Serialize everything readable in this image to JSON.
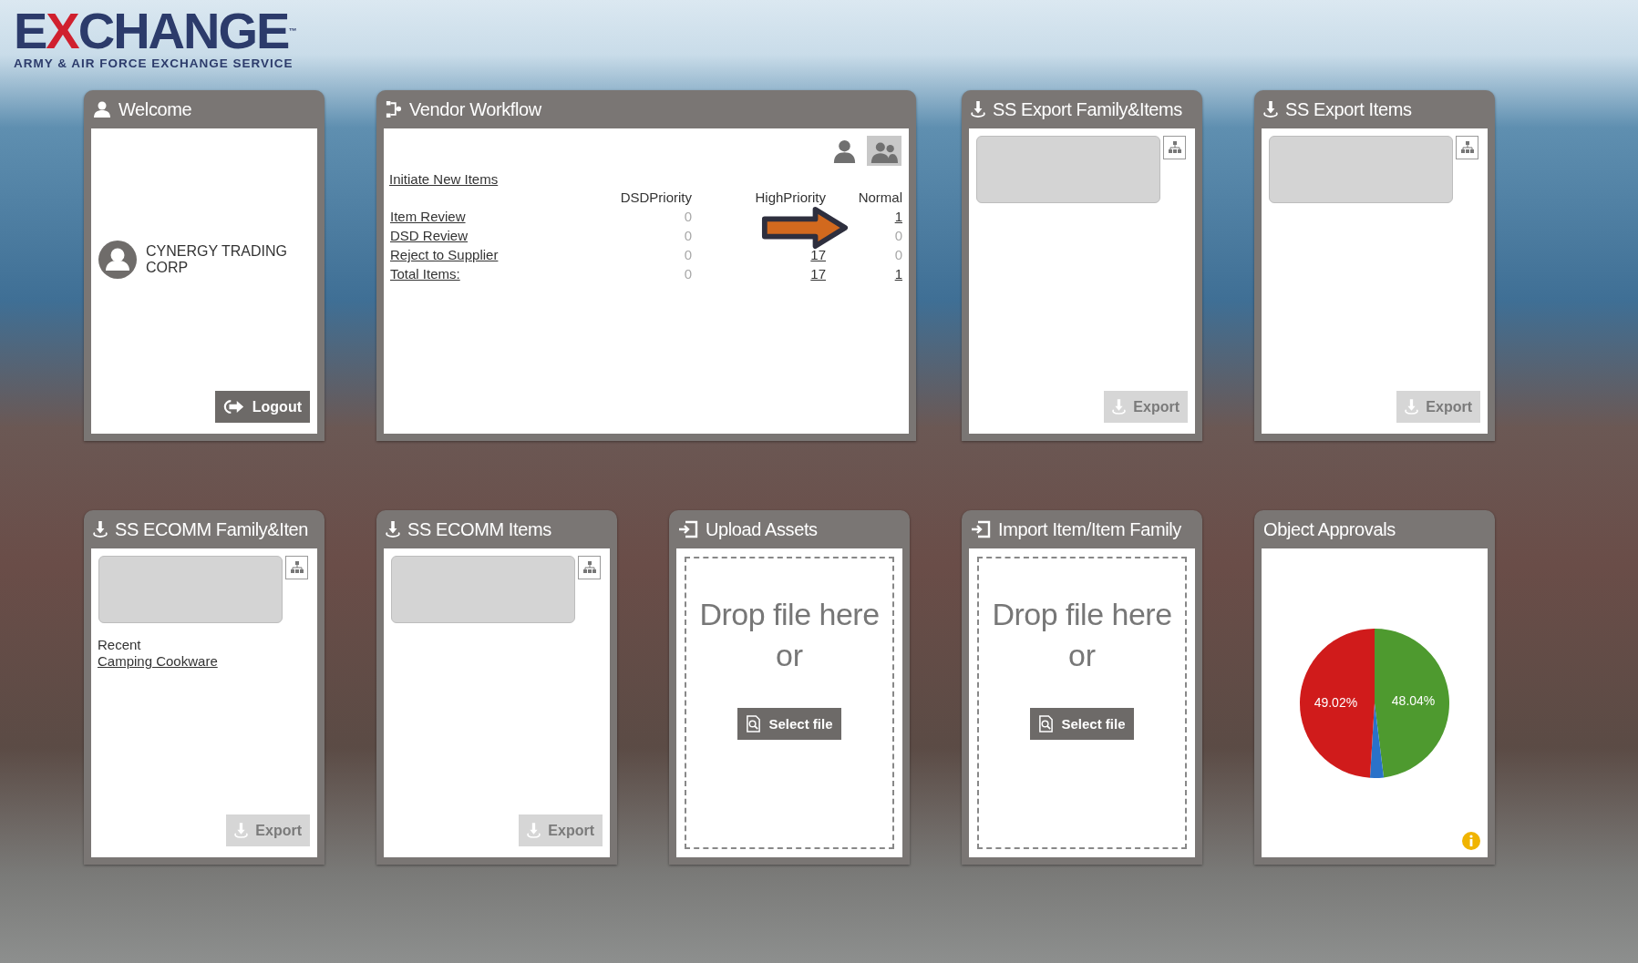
{
  "logo": {
    "parts": [
      {
        "text": "E",
        "color": "#2c3b6b"
      },
      {
        "text": "X",
        "color": "#d0202e"
      },
      {
        "text": "CHANGE",
        "color": "#2c3b6b"
      }
    ],
    "trademark": "™",
    "tagline": "ARMY & AIR FORCE EXCHANGE SERVICE"
  },
  "widgets": [
    {
      "kind": "welcome",
      "title": "Welcome",
      "user_name": "CYNERGY TRADING CORP",
      "logout_button": "Logout"
    },
    {
      "kind": "workflow",
      "title": "Vendor Workflow",
      "view_toggles": [
        {
          "kind": "single",
          "selected": false
        },
        {
          "kind": "group",
          "selected": true
        }
      ],
      "initiate_link": "Initiate New Items",
      "columns": [
        "DSDPriority",
        "HighPriority",
        "Normal"
      ],
      "rows": [
        {
          "label": "Item Review",
          "cells": [
            {
              "text": "0",
              "link": false
            },
            null,
            {
              "text": "1",
              "link": true
            }
          ]
        },
        {
          "label": "DSD Review",
          "cells": [
            {
              "text": "0",
              "link": false
            },
            null,
            {
              "text": "0",
              "link": false
            }
          ]
        },
        {
          "label": "Reject to Supplier",
          "cells": [
            {
              "text": "0",
              "link": false
            },
            {
              "text": "17",
              "link": true
            },
            {
              "text": "0",
              "link": false
            }
          ]
        },
        {
          "label": "Total Items:",
          "cells": [
            {
              "text": "0",
              "link": false
            },
            {
              "text": "17",
              "link": true
            },
            {
              "text": "1",
              "link": true
            }
          ]
        }
      ]
    },
    {
      "kind": "export",
      "title": "SS Export Family&Items",
      "export_button": {
        "label": "Export",
        "disabled": true
      }
    },
    {
      "kind": "export",
      "title": "SS Export Items",
      "export_button": {
        "label": "Export",
        "disabled": true
      }
    },
    {
      "kind": "export",
      "title": "SS ECOMM Family&Iten",
      "recent_label": "Recent",
      "recent_items": [
        "Camping Cookware"
      ],
      "export_button": {
        "label": "Export",
        "disabled": true
      }
    },
    {
      "kind": "export",
      "title": "SS ECOMM Items",
      "export_button": {
        "label": "Export",
        "disabled": true
      }
    },
    {
      "kind": "upload",
      "title": "Upload Assets",
      "drop_text": "Drop file here",
      "or_text": "or",
      "select_button": "Select file"
    },
    {
      "kind": "upload",
      "title": "Import Item/Item Family",
      "drop_text": "Drop file here",
      "or_text": "or",
      "select_button": "Select file"
    },
    {
      "kind": "chart",
      "title": "Object Approvals",
      "info": true,
      "chart_data": {
        "type": "pie",
        "values": [
          48.04,
          2.94,
          49.02
        ],
        "colors": [
          "#4e9a2f",
          "#2a72c9",
          "#d01b1b"
        ],
        "value_labels": [
          "48.04%",
          null,
          "49.02%"
        ]
      }
    }
  ]
}
